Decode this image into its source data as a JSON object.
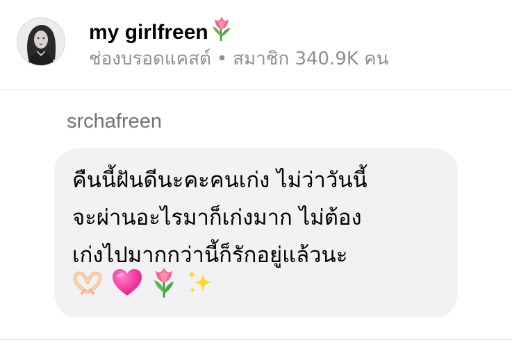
{
  "header": {
    "channel_name": "my girlfreen",
    "title_icon": "tulip-icon",
    "subtitle_type": "ช่องบรอดแคสต์",
    "subtitle_separator": "•",
    "subtitle_members": "สมาชิก 340.9K คน"
  },
  "message": {
    "sender": "srchafreen",
    "lines": [
      "คืนนี้ฝันดีนะคะคนเก่ง ไม่ว่าวันนี้",
      "จะผ่านอะไรมาก็เก่งมาก ไม่ต้อง",
      "เก่งไปมากกว่านี้ก็รักอยู่แล้วนะ"
    ],
    "emojis": [
      "heart-hands-icon",
      "pink-heart-icon",
      "tulip-icon",
      "sparkles-icon"
    ]
  },
  "colors": {
    "bubble_bg": "#f2f2f4",
    "meta_text": "#8e8e93",
    "sender_text": "#737373",
    "divider": "#e5e5e5"
  }
}
